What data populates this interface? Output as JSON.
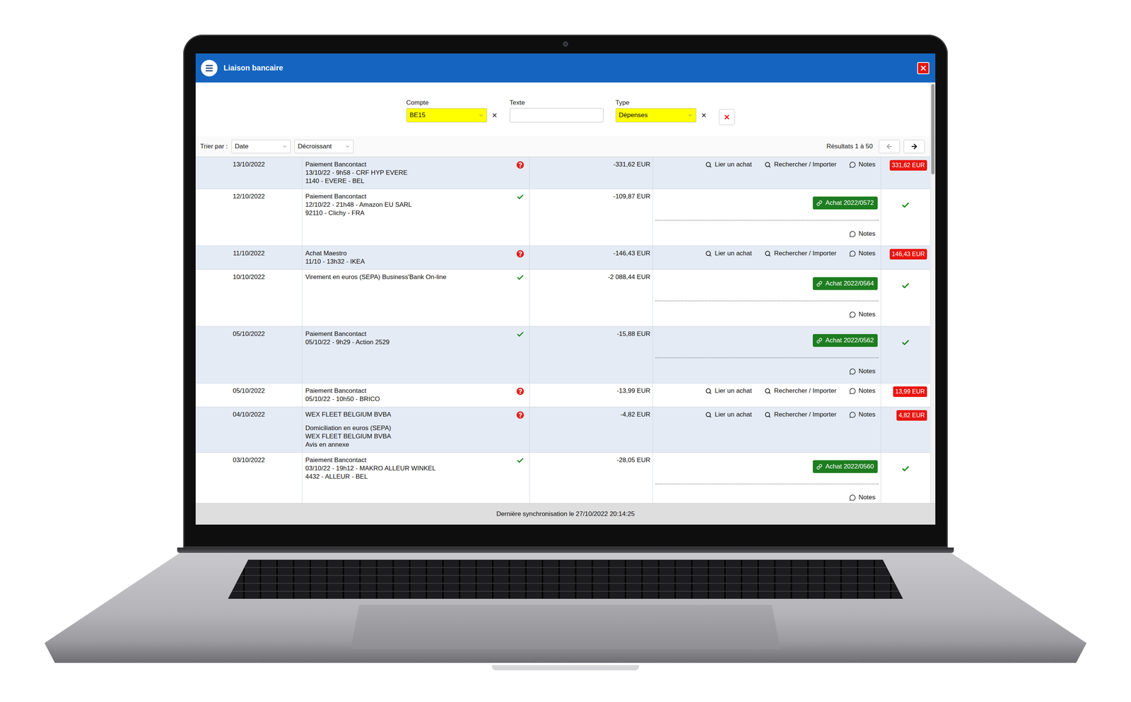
{
  "window": {
    "title": "Liaison bancaire"
  },
  "filters": [
    {
      "label": "Compte",
      "value": "BE15",
      "kind": "select",
      "clearable": true
    },
    {
      "label": "Texte",
      "value": "",
      "kind": "text",
      "clearable": false
    },
    {
      "label": "Type",
      "value": "Dépenses",
      "kind": "select",
      "clearable": true
    }
  ],
  "sort": {
    "label": "Trier par :",
    "field": "Date",
    "order": "Décroissant"
  },
  "pagination": {
    "results": "Résultats 1 à 50"
  },
  "actions": {
    "link": "Lier un achat",
    "search": "Rechercher / Importer",
    "notes": "Notes"
  },
  "rows": [
    {
      "date": "13/10/2022",
      "paragraphs": [
        [
          "Paiement Bancontact",
          "13/10/22 - 9h58 - CRF HYP EVERE",
          "1140 - EVERE - BEL"
        ]
      ],
      "matched": false,
      "amount": "-331,62 EUR",
      "badge": "331,62 EUR"
    },
    {
      "date": "12/10/2022",
      "paragraphs": [
        [
          "Paiement Bancontact",
          "12/10/22 - 21h48 - Amazon EU SARL",
          "92110 - Clichy - FRA"
        ]
      ],
      "matched": true,
      "amount": "-109,87 EUR",
      "badge": "Achat 2022/0572"
    },
    {
      "date": "11/10/2022",
      "paragraphs": [
        [
          "Achat Maestro",
          "11/10 - 13h32 - IKEA"
        ]
      ],
      "matched": false,
      "amount": "-146,43 EUR",
      "badge": "146,43 EUR"
    },
    {
      "date": "10/10/2022",
      "paragraphs": [
        [
          "Virement en euros (SEPA) Business'Bank On-line"
        ]
      ],
      "matched": true,
      "amount": "-2 088,44 EUR",
      "badge": "Achat 2022/0564"
    },
    {
      "date": "05/10/2022",
      "paragraphs": [
        [
          "Paiement Bancontact",
          "05/10/22 - 9h29 - Action 2529"
        ]
      ],
      "matched": true,
      "amount": "-15,88 EUR",
      "badge": "Achat 2022/0562"
    },
    {
      "date": "05/10/2022",
      "paragraphs": [
        [
          "Paiement Bancontact",
          "05/10/22 - 10h50 - BRICO"
        ]
      ],
      "matched": false,
      "amount": "-13,99 EUR",
      "badge": "13,99 EUR"
    },
    {
      "date": "04/10/2022",
      "paragraphs": [
        [
          "WEX FLEET BELGIUM BVBA"
        ],
        [
          "Domiciliation en euros (SEPA)",
          "WEX FLEET BELGIUM BVBA",
          "Avis en annexe"
        ]
      ],
      "matched": false,
      "amount": "-4,82 EUR",
      "badge": "4,82 EUR"
    },
    {
      "date": "03/10/2022",
      "paragraphs": [
        [
          "Paiement Bancontact",
          "03/10/22 - 19h12 - MAKRO ALLEUR WINKEL",
          "4432 - ALLEUR - BEL"
        ]
      ],
      "matched": true,
      "amount": "-28,05 EUR",
      "badge": "Achat 2022/0560"
    }
  ],
  "status_bar": "Dernière synchronisation le 27/10/2022 20:14:25"
}
